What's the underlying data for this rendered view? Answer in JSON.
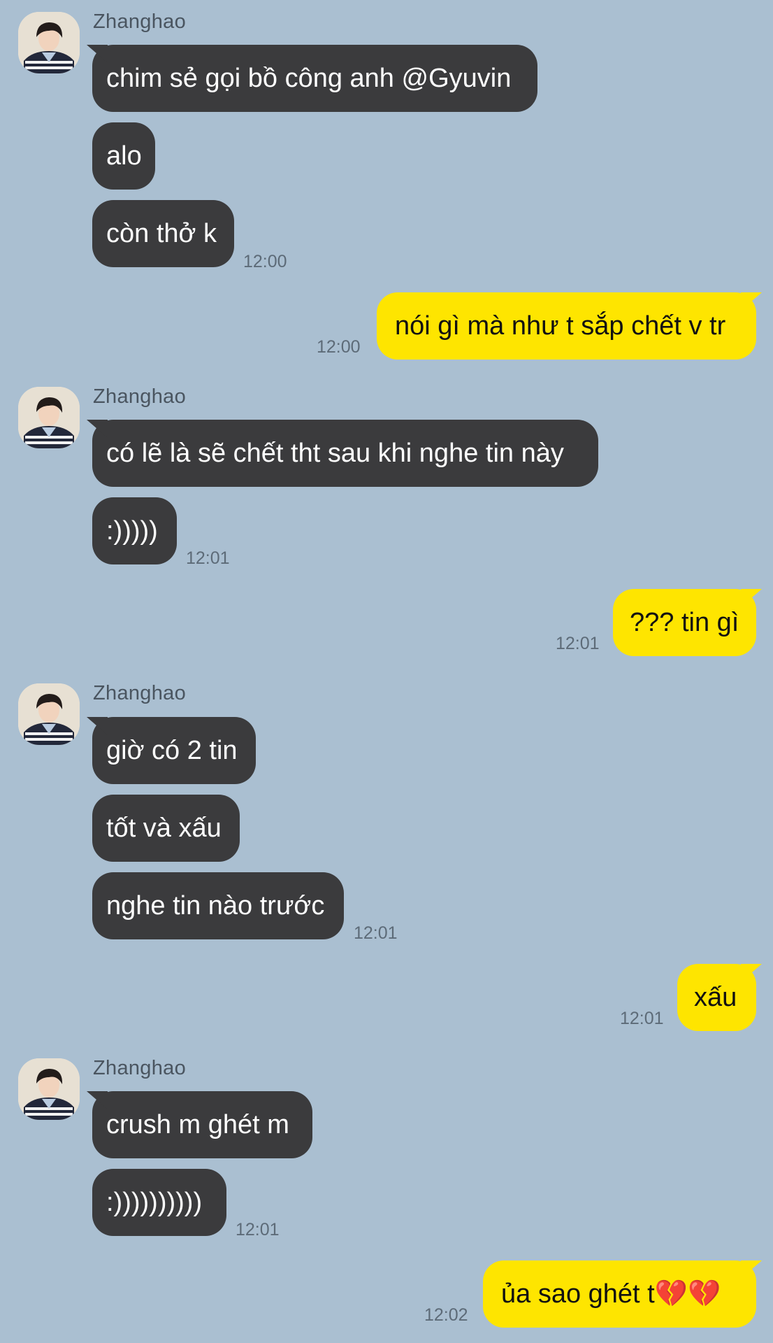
{
  "colors": {
    "background": "#aabfd1",
    "incoming_bubble": "#3b3b3d",
    "outgoing_bubble": "#fee500",
    "incoming_text": "#ffffff",
    "outgoing_text": "#111111"
  },
  "sender_name": "Zhanghao",
  "groups": [
    {
      "sender": "Zhanghao",
      "messages": [
        "chim sẻ gọi bồ công anh @Gyuvin",
        "alo",
        "còn thở k"
      ],
      "time": "12:00"
    },
    {
      "outgoing": "nói gì mà như t sắp chết v tr",
      "time": "12:00"
    },
    {
      "sender": "Zhanghao",
      "messages": [
        "có lẽ là sẽ chết tht sau khi nghe tin này",
        ":)))))"
      ],
      "time": "12:01"
    },
    {
      "outgoing": "??? tin gì",
      "time": "12:01"
    },
    {
      "sender": "Zhanghao",
      "messages": [
        "giờ có 2 tin",
        "tốt và xấu",
        "nghe tin nào trước"
      ],
      "time": "12:01"
    },
    {
      "outgoing": "xấu",
      "time": "12:01"
    },
    {
      "sender": "Zhanghao",
      "messages": [
        "crush m ghét m",
        ":))))))))))"
      ],
      "time": "12:01"
    },
    {
      "outgoing": "ủa sao ghét t💔💔",
      "time": "12:02"
    }
  ]
}
